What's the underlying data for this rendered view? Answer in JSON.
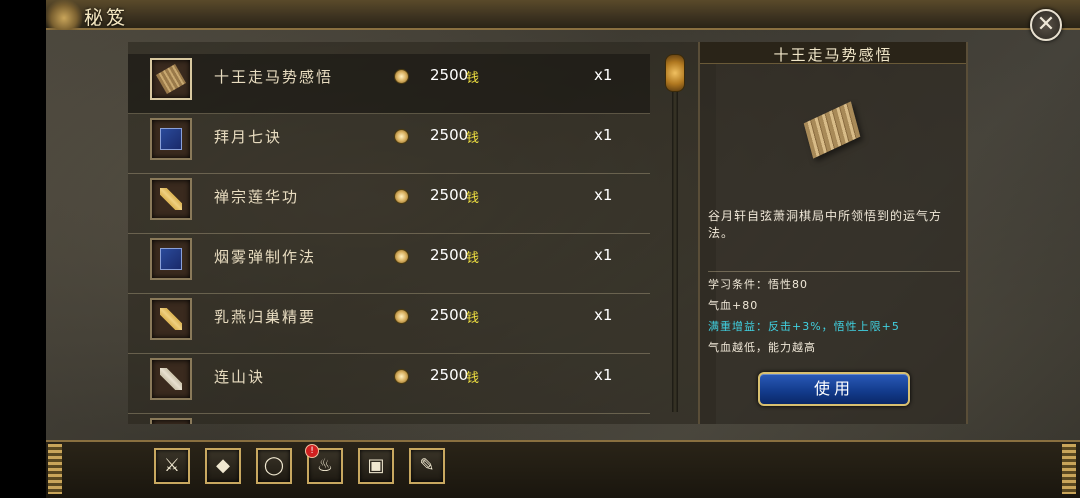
{
  "window": {
    "title": "秘笈",
    "close_icon": "close-icon"
  },
  "list": {
    "items": [
      {
        "name": "十王走马势感悟",
        "icon": "bamboo-scroll-icon",
        "price": "2500",
        "currency": "钱",
        "qty": "x1",
        "selected": true
      },
      {
        "name": "拜月七诀",
        "icon": "blue-book-icon",
        "price": "2500",
        "currency": "钱",
        "qty": "x1"
      },
      {
        "name": "禅宗莲华功",
        "icon": "gold-scroll-icon",
        "price": "2500",
        "currency": "钱",
        "qty": "x1"
      },
      {
        "name": "烟雾弹制作法",
        "icon": "blue-book-icon",
        "price": "2500",
        "currency": "钱",
        "qty": "x1"
      },
      {
        "name": "乳燕归巢精要",
        "icon": "gold-scroll-icon",
        "price": "2500",
        "currency": "钱",
        "qty": "x1"
      },
      {
        "name": "连山诀",
        "icon": "white-scroll-icon",
        "price": "2500",
        "currency": "钱",
        "qty": "x1"
      }
    ]
  },
  "detail": {
    "title": "十王走马势感悟",
    "image_icon": "bamboo-scroll-icon",
    "description": "谷月轩自弦萧洞棋局中所领悟到的运气方法。",
    "requirement": "学习条件：悟性80",
    "bonus": "气血+80",
    "full_bonus": "满重增益：反击+3%，悟性上限+5",
    "note": "气血越低，能力越高",
    "use_label": "使用"
  },
  "toolbar": {
    "buttons": [
      {
        "icon": "sword-icon",
        "glyph": "⚔"
      },
      {
        "icon": "armor-icon",
        "glyph": "◆"
      },
      {
        "icon": "ring-icon",
        "glyph": "◯"
      },
      {
        "icon": "gourd-icon",
        "glyph": "♨",
        "badge": "!"
      },
      {
        "icon": "chest-icon",
        "glyph": "▣"
      },
      {
        "icon": "scroll-icon",
        "glyph": "✎"
      }
    ]
  },
  "colors": {
    "accent_gold": "#c8a860",
    "price_text": "#ffffff",
    "currency_text": "#f0e040",
    "bonus_cyan": "#40d0e0",
    "use_button": "#1a4aa8"
  }
}
